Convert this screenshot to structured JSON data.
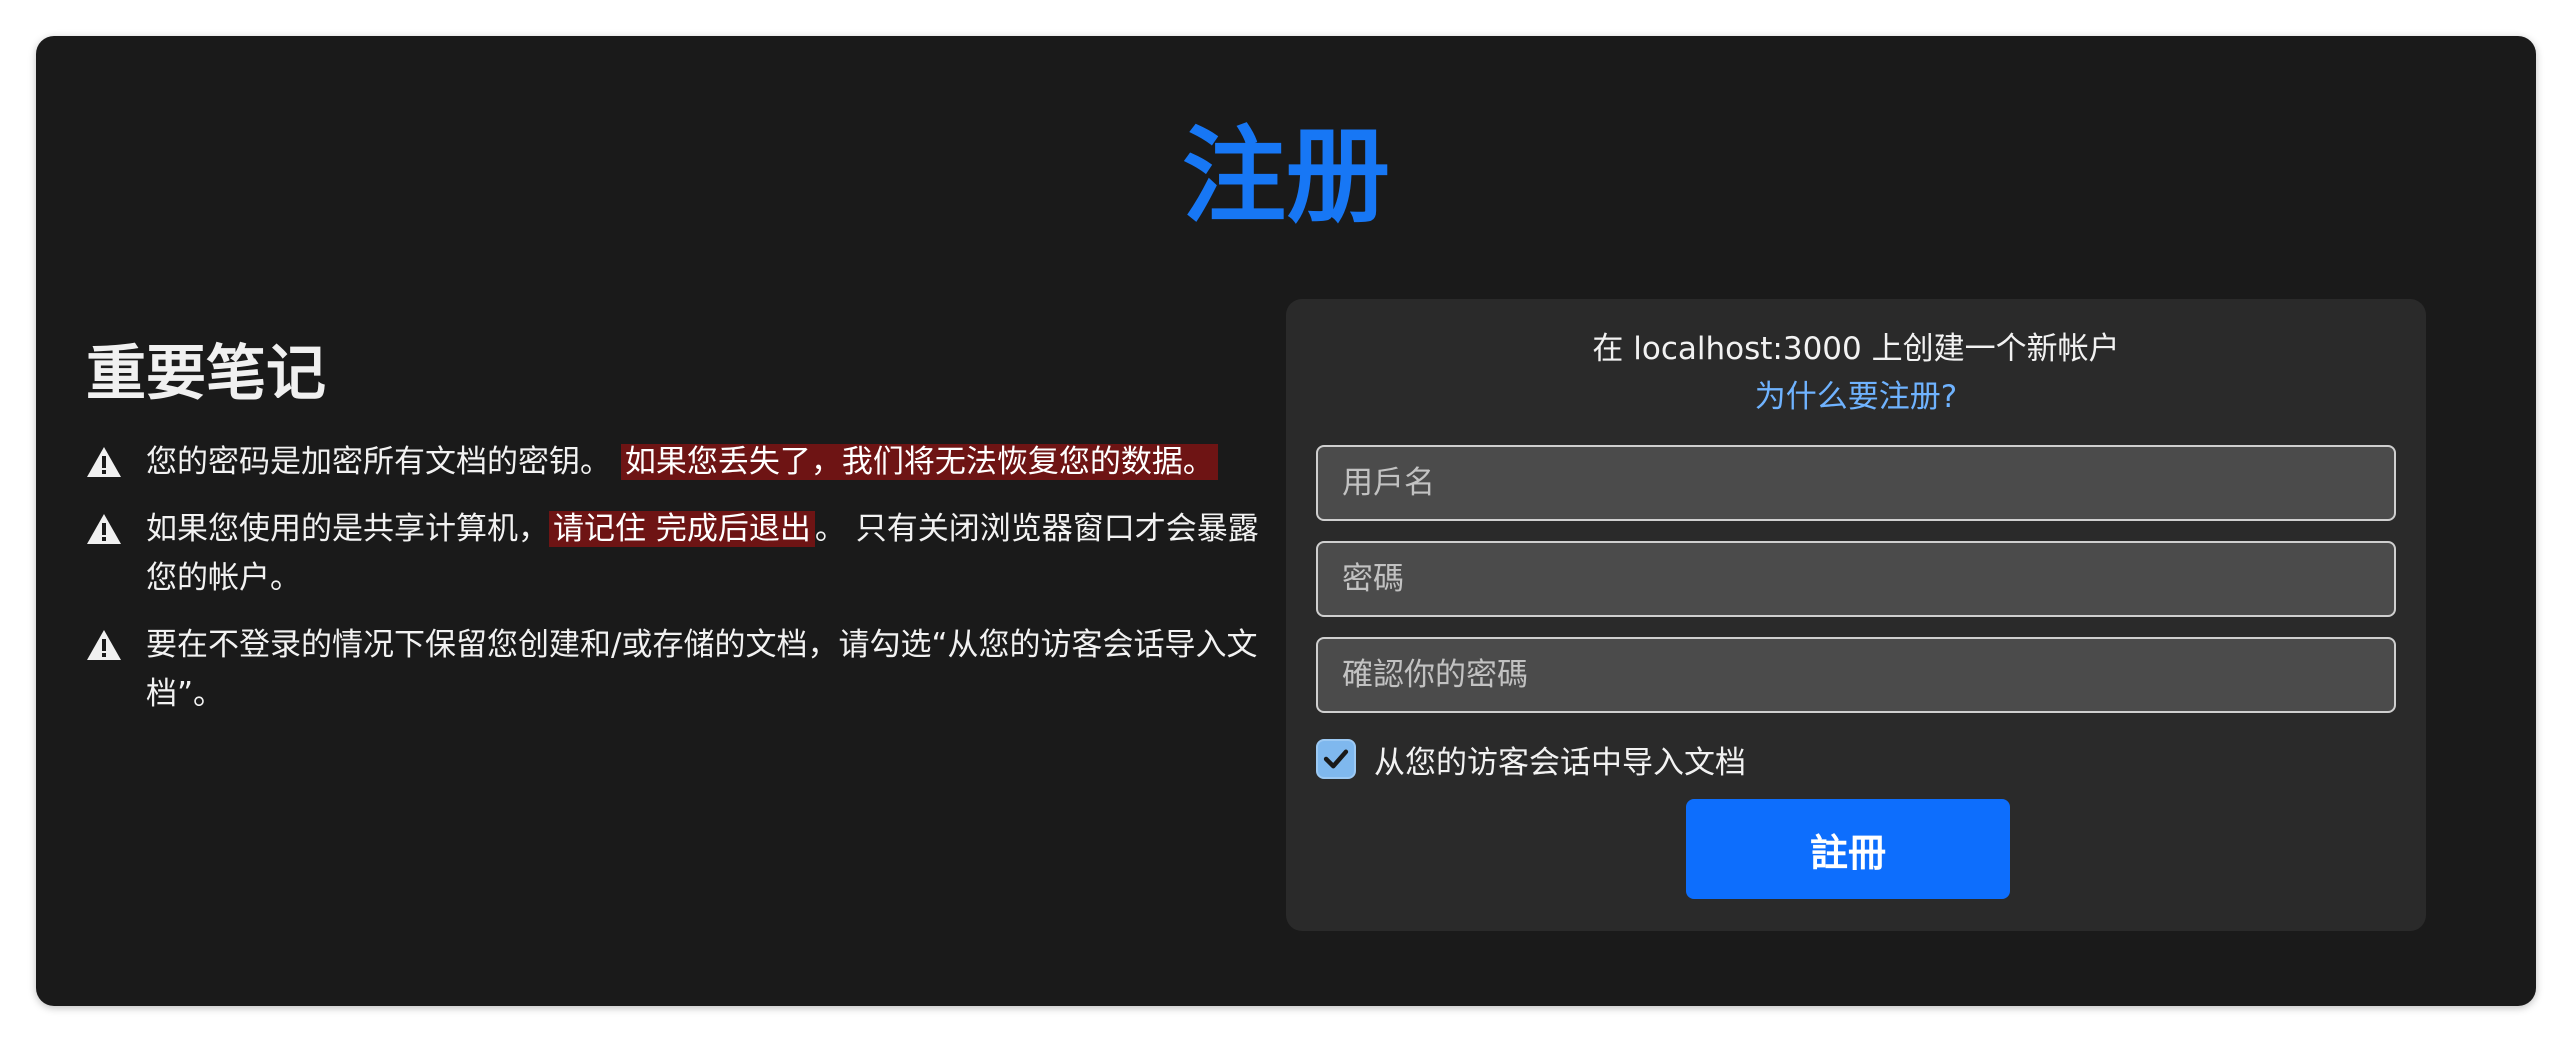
{
  "page": {
    "title": "注册"
  },
  "notes": {
    "heading": "重要笔记",
    "items": [
      {
        "icon": "warning-icon",
        "text_before": "您的密码是加密所有文档的密钥。",
        "highlight": "如果您丢失了，我们将无法恢复您的数据。",
        "text_after": ""
      },
      {
        "icon": "warning-icon",
        "text_before": "如果您使用的是共享计算机，",
        "highlight": "请记住 完成后退出",
        "text_after": "。 只有关闭浏览器窗口才会暴露您的帐户。"
      },
      {
        "icon": "warning-icon",
        "text_before": "要在不登录的情况下保留您创建和/或存储的文档，请勾选“从您的访客会话导入文档”。",
        "highlight": "",
        "text_after": ""
      }
    ]
  },
  "form": {
    "title": "在 localhost:3000 上创建一个新帐户",
    "why_link": "为什么要注册?",
    "username": {
      "placeholder": "用戶名",
      "value": ""
    },
    "password": {
      "placeholder": "密碼",
      "value": ""
    },
    "confirm_password": {
      "placeholder": "確認你的密碼",
      "value": ""
    },
    "import_checkbox": {
      "label": "从您的访客会话中导入文档",
      "checked": true
    },
    "submit_label": "註冊"
  },
  "colors": {
    "background": "#1a1a1a",
    "panel": "#2a2a2a",
    "accent": "#1777f5",
    "link": "#6fb3ff",
    "highlight": "#6e1414",
    "button": "#0d6efd",
    "checkbox": "#7fb8ee"
  }
}
